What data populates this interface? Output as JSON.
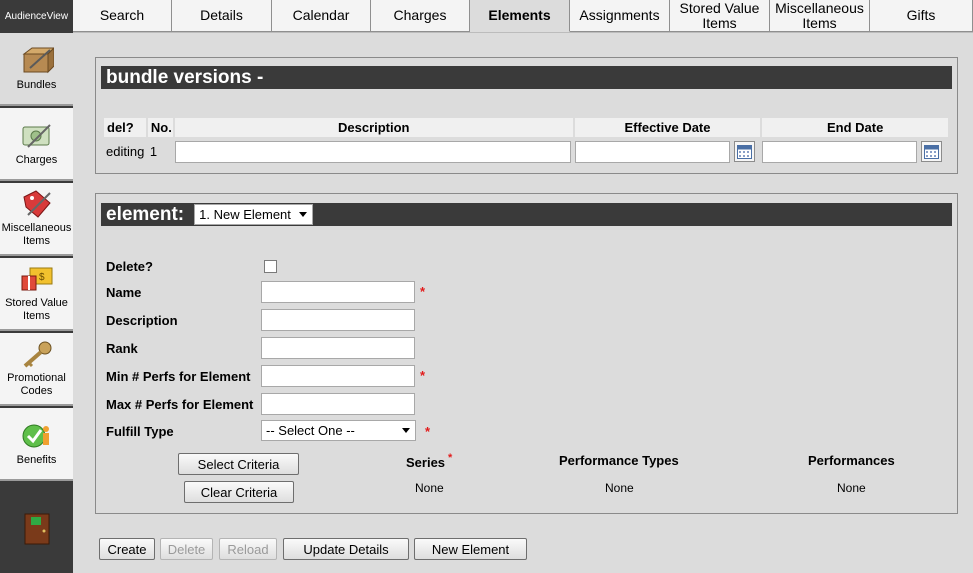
{
  "brand": "AudienceView",
  "tabs": [
    {
      "label": "Search",
      "active": false
    },
    {
      "label": "Details",
      "active": false
    },
    {
      "label": "Calendar",
      "active": false
    },
    {
      "label": "Charges",
      "active": false
    },
    {
      "label": "Elements",
      "active": true
    },
    {
      "label": "Assignments",
      "active": false
    },
    {
      "label": "Stored Value Items",
      "active": false
    },
    {
      "label": "Miscellaneous Items",
      "active": false
    },
    {
      "label": "Gifts",
      "active": false
    }
  ],
  "sidebar": {
    "items": [
      {
        "label": "Bundles",
        "icon": "bundle-box-icon"
      },
      {
        "label": "Charges",
        "icon": "charges-icon"
      },
      {
        "label": "Miscellaneous Items",
        "icon": "misc-tag-icon"
      },
      {
        "label": "Stored Value Items",
        "icon": "gift-card-icon"
      },
      {
        "label": "Promotional Codes",
        "icon": "key-icon"
      },
      {
        "label": "Benefits",
        "icon": "benefits-person-icon"
      }
    ],
    "exit_icon": "exit-door-icon"
  },
  "versions": {
    "title": "bundle versions -",
    "columns": [
      "del?",
      "No.",
      "Description",
      "Effective Date",
      "End Date"
    ],
    "row": {
      "del": "editing",
      "no": "1",
      "description": "",
      "effective_date": "",
      "end_date": ""
    }
  },
  "element": {
    "title": "element:",
    "selected": "1. New Element",
    "fields": {
      "delete": "Delete?",
      "name": "Name",
      "description": "Description",
      "rank": "Rank",
      "min_perfs": "Min # Perfs for Element",
      "max_perfs": "Max # Perfs for Element",
      "fulfill_type": "Fulfill Type",
      "fulfill_placeholder": "-- Select One --"
    },
    "required_mark": "*",
    "select_criteria": "Select Criteria",
    "clear_criteria": "Clear Criteria",
    "criteria": {
      "series": {
        "label": "Series",
        "value": "None"
      },
      "performance_types": {
        "label": "Performance Types",
        "value": "None"
      },
      "performances": {
        "label": "Performances",
        "value": "None"
      }
    }
  },
  "actions": {
    "create": "Create",
    "delete": "Delete",
    "reload": "Reload",
    "update_details": "Update Details",
    "new_element": "New Element"
  }
}
